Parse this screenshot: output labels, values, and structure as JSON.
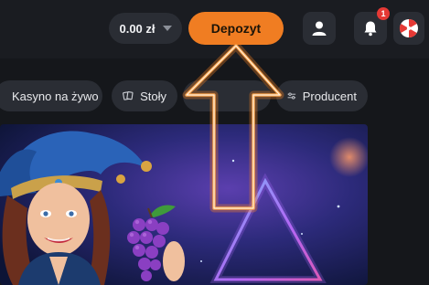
{
  "header": {
    "balance": "0.00 zł",
    "deposit_label": "Depozyt",
    "notification_count": "1"
  },
  "categories": [
    {
      "label": "Kasyno na żywo",
      "icon": "live-casino-icon"
    },
    {
      "label": "Stoły",
      "icon": "cards-icon"
    },
    {
      "label": "Producent",
      "icon": "filter-sliders-icon"
    }
  ],
  "colors": {
    "accent": "#f07d22",
    "background": "#15171b",
    "surface": "#2a2d34",
    "badge": "#e53935"
  }
}
